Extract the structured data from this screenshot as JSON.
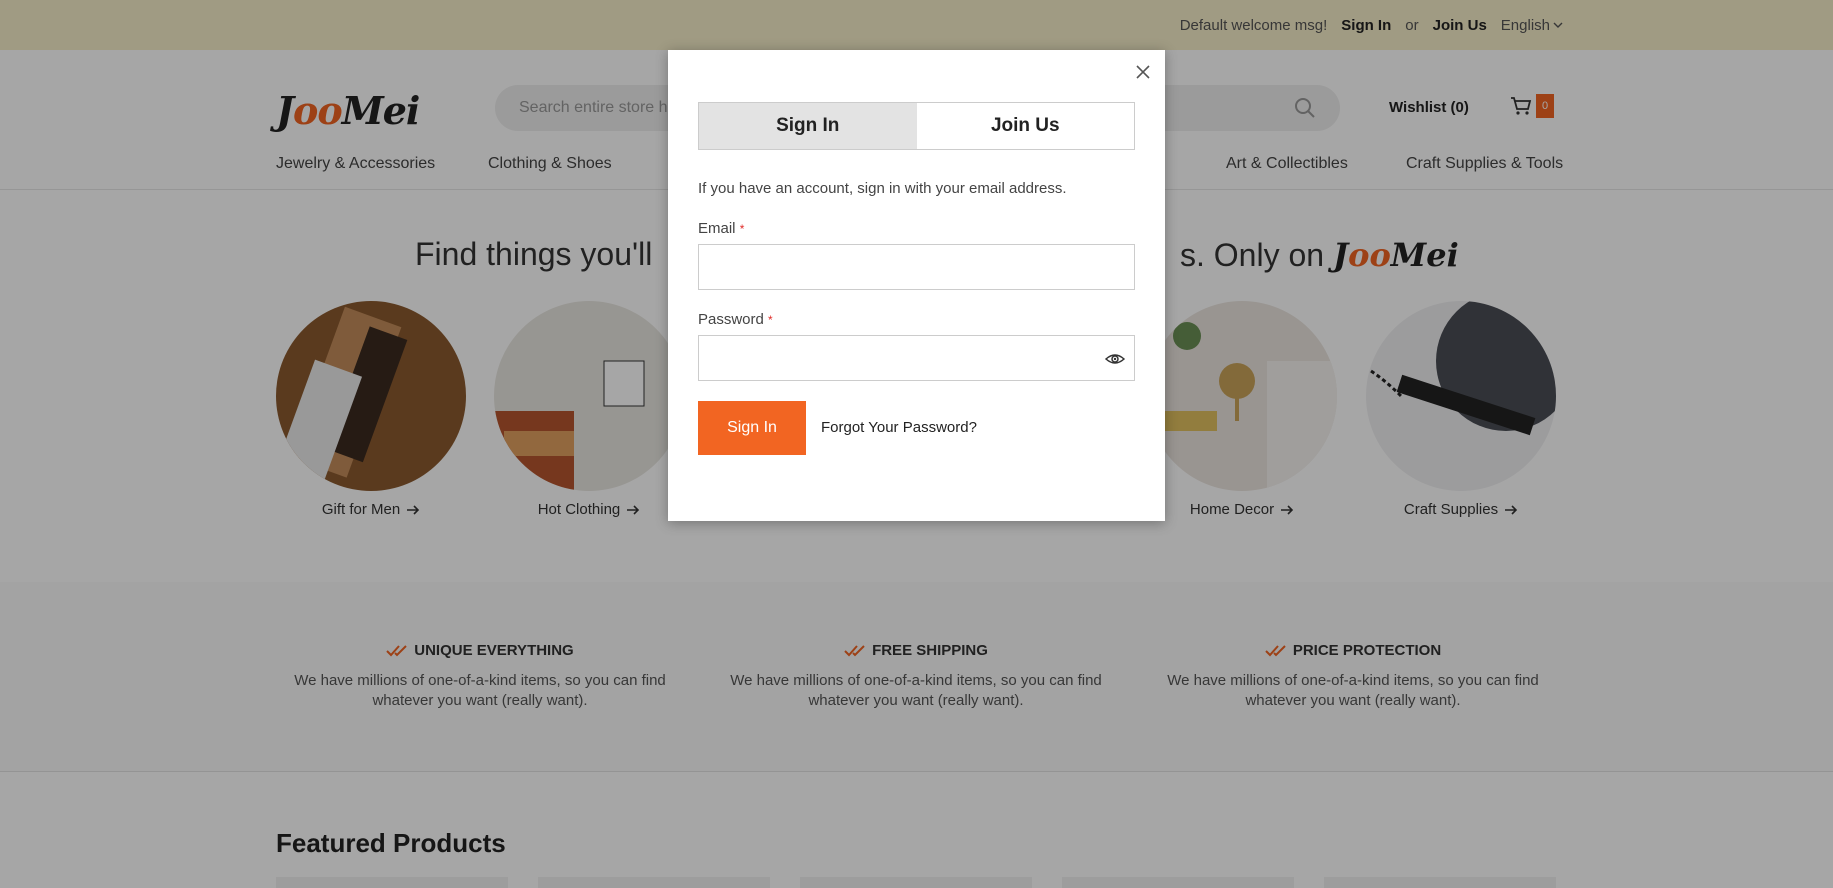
{
  "topbar": {
    "welcome": "Default welcome msg!",
    "sign_in": "Sign In",
    "or": "or",
    "join_us": "Join Us",
    "language": "English",
    "background": "#f6eec9"
  },
  "header": {
    "logo_part1": "Joo",
    "logo_part2": "Mei",
    "search_placeholder": "Search entire store here...",
    "wishlist": "Wishlist (0)",
    "cart_count": "0",
    "nav": [
      "Jewelry & Accessories",
      "Clothing & Shoes",
      "Art & Collectibles",
      "Craft Supplies & Tools"
    ]
  },
  "hero": {
    "title_left": "Find things you'll",
    "title_right": "s. Only on",
    "categories": [
      {
        "label": "Gift for Men",
        "icon": "arrow-right-icon"
      },
      {
        "label": "Hot Clothing",
        "icon": "arrow-right-icon"
      },
      {
        "label": "Home Decor",
        "icon": "arrow-right-icon"
      },
      {
        "label": "Craft Supplies",
        "icon": "arrow-right-icon"
      }
    ]
  },
  "features": [
    {
      "title": "UNIQUE EVERYTHING",
      "desc": "We have millions of one-of-a-kind items, so you can find whatever you want (really want)."
    },
    {
      "title": "FREE SHIPPING",
      "desc": "We have millions of one-of-a-kind items, so you can find whatever you want (really want)."
    },
    {
      "title": "PRICE PROTECTION",
      "desc": "We have millions of one-of-a-kind items, so you can find whatever you want (really want)."
    }
  ],
  "featured": {
    "title": "Featured Products"
  },
  "modal": {
    "tab_signin": "Sign In",
    "tab_join": "Join Us",
    "hint": "If you have an account, sign in with your email address.",
    "email_label": "Email",
    "password_label": "Password",
    "required_mark": "*",
    "email_value": "",
    "password_value": "",
    "submit": "Sign In",
    "forgot": "Forgot Your Password?"
  },
  "colors": {
    "accent": "#f26522",
    "overlay": "rgba(0,0,0,0.35)"
  }
}
